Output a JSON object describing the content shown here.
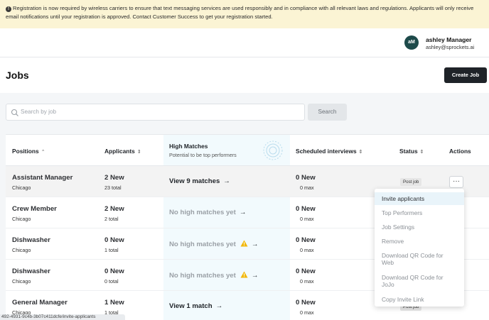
{
  "banner": {
    "icon": "info-circle-icon",
    "text": "Registration is now required by wireless carriers to ensure that text messaging services are used responsibly and in compliance with all relevant laws and regulations. Applicants will only receive email notifications until your registration is approved. Contact Customer Success to get your registration started."
  },
  "user": {
    "initials": "aM",
    "name": "ashley Manager",
    "email": "ashley@sprockets.ai",
    "avatar_color": "#1d4a4a"
  },
  "page": {
    "title": "Jobs",
    "create_label": "Create Job"
  },
  "search": {
    "placeholder": "Search by job",
    "button_label": "Search"
  },
  "table": {
    "headers": {
      "positions": "Positions",
      "applicants": "Applicants",
      "high_matches": "High Matches",
      "high_matches_sub": "Potential to be top performers",
      "scheduled": "Scheduled interviews",
      "status": "Status",
      "actions": "Actions"
    },
    "rows": [
      {
        "title": "Assistant Manager",
        "city": "Chicago",
        "new": "2 New",
        "total": "23 total",
        "match": "View 9 matches",
        "int_new": "0 New",
        "int_max": "0 max",
        "status": "Post job"
      },
      {
        "title": "Crew Member",
        "city": "Chicago",
        "new": "2 New",
        "total": "2 total",
        "match": "No high matches yet",
        "int_new": "0 New",
        "int_max": "0 max"
      },
      {
        "title": "Dishwasher",
        "city": "Chicago",
        "new": "0 New",
        "total": "1 total",
        "match": "No high matches yet",
        "int_new": "0 New",
        "int_max": "0 max"
      },
      {
        "title": "Dishwasher",
        "city": "Chicago",
        "new": "0 New",
        "total": "0 total",
        "match": "No high matches yet",
        "int_new": "0 New",
        "int_max": "0 max"
      },
      {
        "title": "General Manager",
        "city": "Chicago",
        "new": "1 New",
        "total": "1 total",
        "match": "View 1 match",
        "int_new": "0 New",
        "int_max": "0 max",
        "status": "Post job"
      }
    ]
  },
  "menu": {
    "items": [
      "Invite applicants",
      "Top Performers",
      "Job Settings",
      "Remove",
      "Download QR Code for Web",
      "Download QR Code for JoJo",
      "Copy Invite Link"
    ]
  },
  "status_url": "492-4931-9c4b-3b07c411dcfe/invite-applicants",
  "colors": {
    "banner_bg": "#fbf4d4",
    "highlight": "#e5f4fb",
    "warning": "#f2b705"
  }
}
